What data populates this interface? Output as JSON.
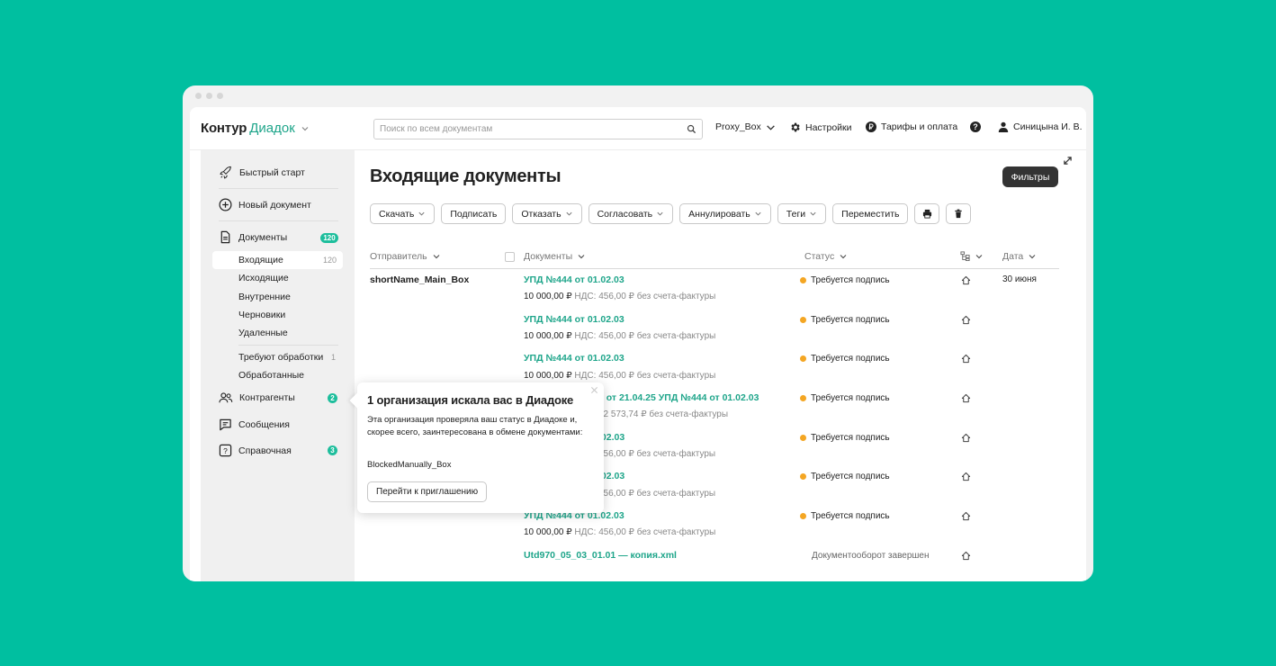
{
  "header": {
    "brand": "Контур",
    "product": "Диадок",
    "search_placeholder": "Поиск по всем документам",
    "box": "Proxy_Box",
    "settings": "Настройки",
    "tariffs": "Тарифы и оплата",
    "user": "Синицына И. В."
  },
  "sidebar": {
    "quick_start": "Быстрый старт",
    "new_document": "Новый документ",
    "documents": "Документы",
    "documents_count": "120",
    "incoming": "Входящие",
    "incoming_count": "120",
    "outgoing": "Исходящие",
    "internal": "Внутренние",
    "drafts": "Черновики",
    "deleted": "Удаленные",
    "need_processing": "Требуют обработки",
    "need_processing_count": "1",
    "processed": "Обработанные",
    "counterparties": "Контрагенты",
    "counterparties_count": "2",
    "messages": "Сообщения",
    "reference": "Справочная",
    "reference_count": "3"
  },
  "main": {
    "title": "Входящие документы",
    "filters": "Фильтры",
    "toolbar": {
      "download": "Скачать",
      "sign": "Подписать",
      "refuse": "Отказать",
      "approve": "Согласовать",
      "annul": "Аннулировать",
      "tags": "Теги",
      "move": "Переместить"
    },
    "columns": {
      "sender": "Отправитель",
      "documents": "Документы",
      "status": "Статус",
      "date": "Дата"
    },
    "sender": "shortName_Main_Box",
    "date": "30 июня",
    "rows": [
      {
        "title": "УПД №444 от 01.02.03",
        "amount": "10 000,00 ₽",
        "vat": "НДС: 456,00 ₽ без счета-фактуры",
        "status": "Требуется подпись"
      },
      {
        "title": "УПД №444 от 01.02.03",
        "amount": "10 000,00 ₽",
        "vat": "НДС: 456,00 ₽ без счета-фактуры",
        "status": "Требуется подпись"
      },
      {
        "title": "УПД №444 от 01.02.03",
        "amount": "10 000,00 ₽",
        "vat": "НДС: 456,00 ₽ без счета-фактуры",
        "status": "Требуется подпись"
      },
      {
        "title": "1 от 21.04.25 УПД №444 от 01.02.03",
        "amount": "",
        "vat": "12 573,74 ₽ без счета-фактуры",
        "status": "Требуется подпись"
      },
      {
        "title": ".02.03",
        "amount": "",
        "vat": "456,00 ₽ без счета-фактуры",
        "status": "Требуется подпись"
      },
      {
        "title": ".02.03",
        "amount": "",
        "vat": "456,00 ₽ без счета-фактуры",
        "status": "Требуется подпись"
      },
      {
        "title": "УПД №444 от 01.02.03",
        "amount": "10 000,00 ₽",
        "vat": "НДС: 456,00 ₽ без счета-фактуры",
        "status": "Требуется подпись"
      },
      {
        "title": "Utd970_05_03_01.01 — копия.xml",
        "amount": "",
        "vat": "",
        "status": "Документооборот завершен"
      }
    ]
  },
  "popover": {
    "title": "1 организация искала вас в Диадоке",
    "text": "Эта организация проверяла ваш статус в  Диадоке и, скорее всего, заинтересована в обмене документами:",
    "org": "BlockedManually_Box",
    "button": "Перейти к приглашению"
  },
  "colors": {
    "accent": "#1EA58A",
    "background": "#00BFA0",
    "badge": "#1DBE9C",
    "status_pending": "#F4A623"
  }
}
